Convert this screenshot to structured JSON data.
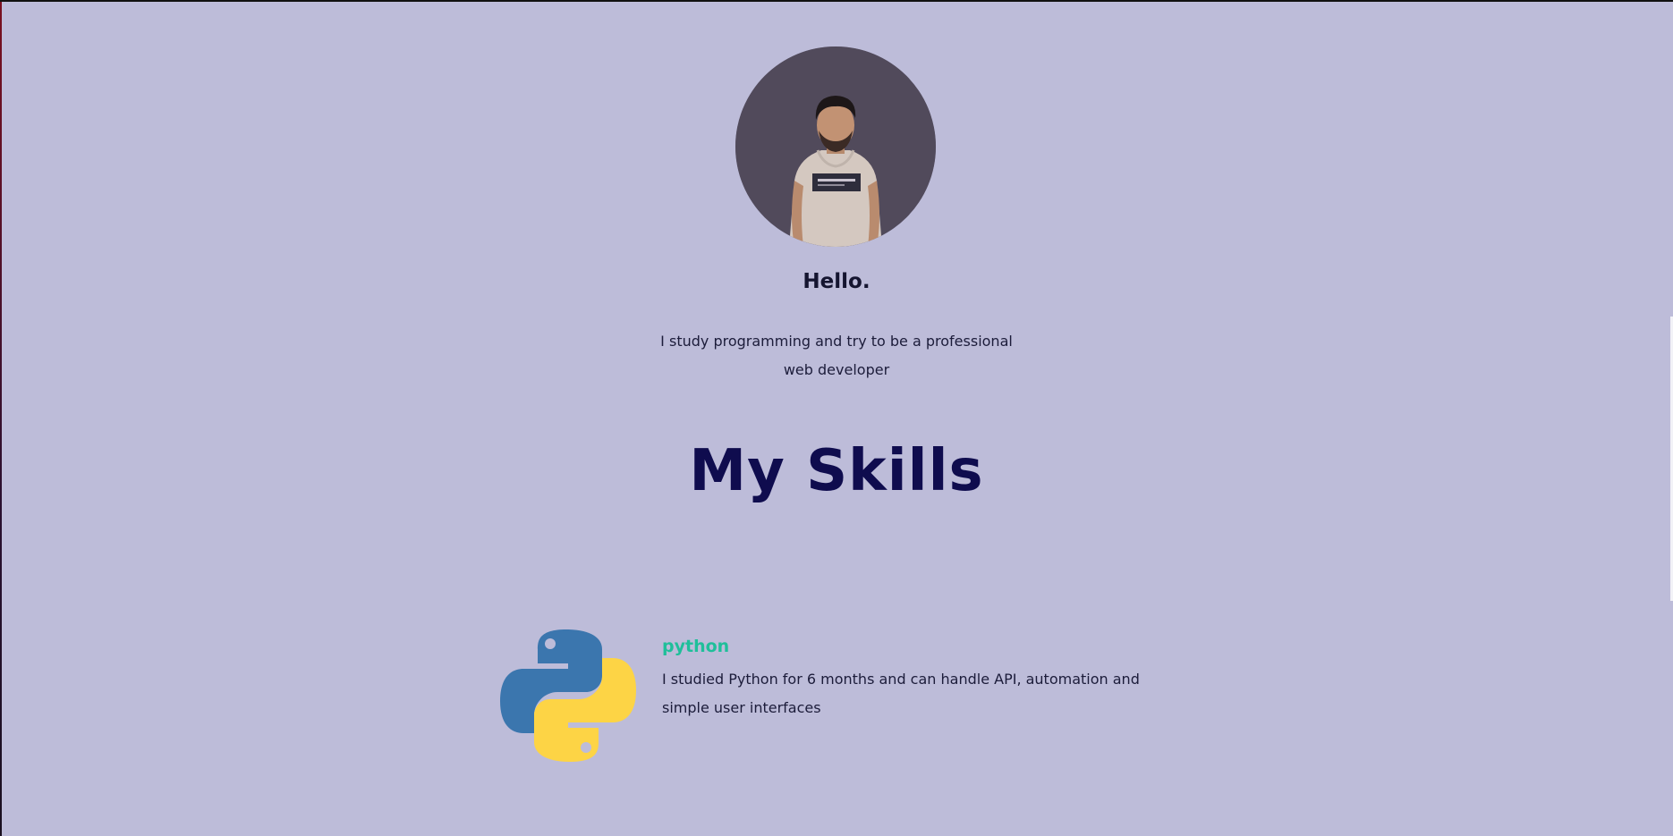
{
  "profile": {
    "avatar": "profile-photo",
    "greeting": "Hello.",
    "intro": "I study programming and try to be a professional web developer"
  },
  "skills_section": {
    "title": "My Skills",
    "items": [
      {
        "icon": "python-logo-icon",
        "name": "python",
        "description": "I studied Python for 6 months and can handle API, automation and simple user interfaces"
      }
    ]
  },
  "colors": {
    "background": "#bdbcd9",
    "title": "#0f0c4e",
    "skill_name": "#1fbf9a",
    "text": "#1c1c3a"
  }
}
